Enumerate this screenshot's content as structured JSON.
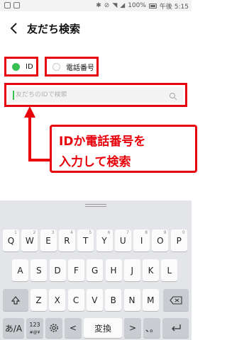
{
  "status_bar": {
    "battery": "100%",
    "time_text": "午後 5:15",
    "icons": [
      "notification-icon",
      "notification-icon",
      "bluetooth-icon",
      "mute-icon",
      "wifi-icon",
      "signal-icon",
      "battery-icon"
    ]
  },
  "header": {
    "title": "友だち検索",
    "back_icon": "back-arrow-icon"
  },
  "search_type": {
    "options": [
      {
        "label": "ID",
        "selected": true
      },
      {
        "label": "電話番号",
        "selected": false
      }
    ]
  },
  "search": {
    "placeholder": "友だちのIDで検索",
    "value": "",
    "icon": "search-icon"
  },
  "callout": {
    "line1": "IDか電話番号を",
    "line2": "入力して検索"
  },
  "keyboard": {
    "row1": [
      "Q",
      "W",
      "E",
      "R",
      "T",
      "Y",
      "U",
      "I",
      "O",
      "P"
    ],
    "row1_hints": [
      "1",
      "2",
      "3",
      "4",
      "5",
      "6",
      "7",
      "8",
      "9",
      "0"
    ],
    "row2": [
      "A",
      "S",
      "D",
      "F",
      "G",
      "H",
      "J",
      "K",
      "L"
    ],
    "row3": [
      "Z",
      "X",
      "C",
      "V",
      "B",
      "N",
      "M"
    ],
    "shift_icon": "shift-icon",
    "backspace_icon": "backspace-icon",
    "mode_label": "あ/A",
    "numbers_label": "123",
    "numbers_sub": "#@¥",
    "settings_icon": "gear-icon",
    "left_label": "<",
    "space_label": "変換",
    "right_label": ">",
    "punct_label": "、。",
    "enter_icon": "enter-icon",
    "accent_color": "#37c052",
    "annotation_color": "#e8000b"
  }
}
